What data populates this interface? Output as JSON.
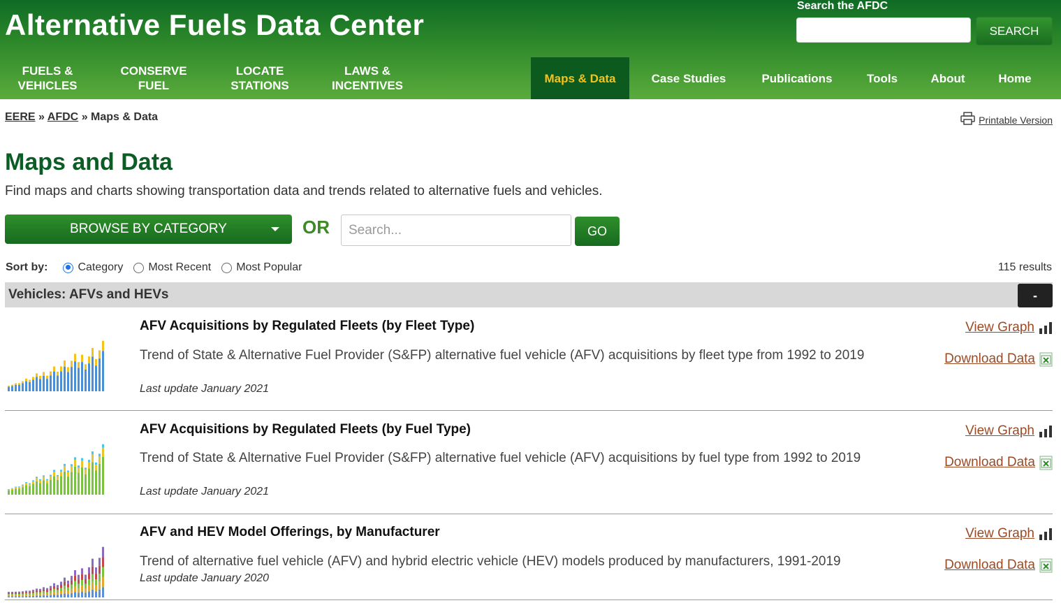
{
  "header": {
    "site_title": "Alternative Fuels Data Center",
    "search_label": "Search the AFDC",
    "search_value": "",
    "search_button": "SEARCH"
  },
  "nav": {
    "fuels_vehicles": "Fuels & Vehicles",
    "conserve_fuel": "Conserve Fuel",
    "locate_stations": "Locate Stations",
    "laws_incentives": "Laws & Incentives",
    "maps_data": "Maps & Data",
    "case_studies": "Case Studies",
    "publications": "Publications",
    "tools": "Tools",
    "about": "About",
    "home": "Home"
  },
  "breadcrumb": {
    "eere": "EERE",
    "sep": "»",
    "afdc": "AFDC",
    "current": "Maps & Data"
  },
  "printable_version": "Printable Version",
  "page": {
    "title": "Maps and Data",
    "description": "Find maps and charts showing transportation data and trends related to alternative fuels and vehicles."
  },
  "controls": {
    "browse_label": "BROWSE BY CATEGORY",
    "or_label": "OR",
    "search_placeholder": "Search...",
    "go_label": "GO"
  },
  "sort": {
    "label": "Sort by:",
    "options": [
      "Category",
      "Most Recent",
      "Most Popular"
    ],
    "selected": "Category",
    "results": "115 results"
  },
  "category": {
    "title": "Vehicles: AFVs and HEVs",
    "collapse_label": "-"
  },
  "items": [
    {
      "title": "AFV Acquisitions by Regulated Fleets (by Fleet Type)",
      "description": "Trend of State & Alternative Fuel Provider (S&FP) alternative fuel vehicle (AFV) acquisitions by fleet type from 1992 to 2019",
      "updated": "Last update January 2021",
      "view_graph": "View Graph",
      "download_data": "Download Data",
      "thumb_colors": [
        "#4a90d9",
        "#f3c31c"
      ]
    },
    {
      "title": "AFV Acquisitions by Regulated Fleets (by Fuel Type)",
      "description": "Trend of State & Alternative Fuel Provider (S&FP) alternative fuel vehicle (AFV) acquisitions by fuel type from 1992 to 2019",
      "updated": "Last update January 2021",
      "view_graph": "View Graph",
      "download_data": "Download Data",
      "thumb_colors": [
        "#7cc242",
        "#e8c52b",
        "#4fc3e8"
      ]
    },
    {
      "title": "AFV and HEV Model Offerings, by Manufacturer",
      "description": "Trend of alternative fuel vehicle (AFV) and hybrid electric vehicle (HEV) models produced by manufacturers, 1991-2019",
      "updated": "Last update January 2020",
      "view_graph": "View Graph",
      "download_data": "Download Data",
      "thumb_colors": [
        "#5b8fd6",
        "#e0a82e",
        "#7cc242",
        "#c24a4a",
        "#8a6bbf"
      ]
    }
  ],
  "colors": {
    "brand_green": "#0f6b25",
    "active_tab_text": "#f6c21a",
    "link_brown": "#9a4b26"
  }
}
